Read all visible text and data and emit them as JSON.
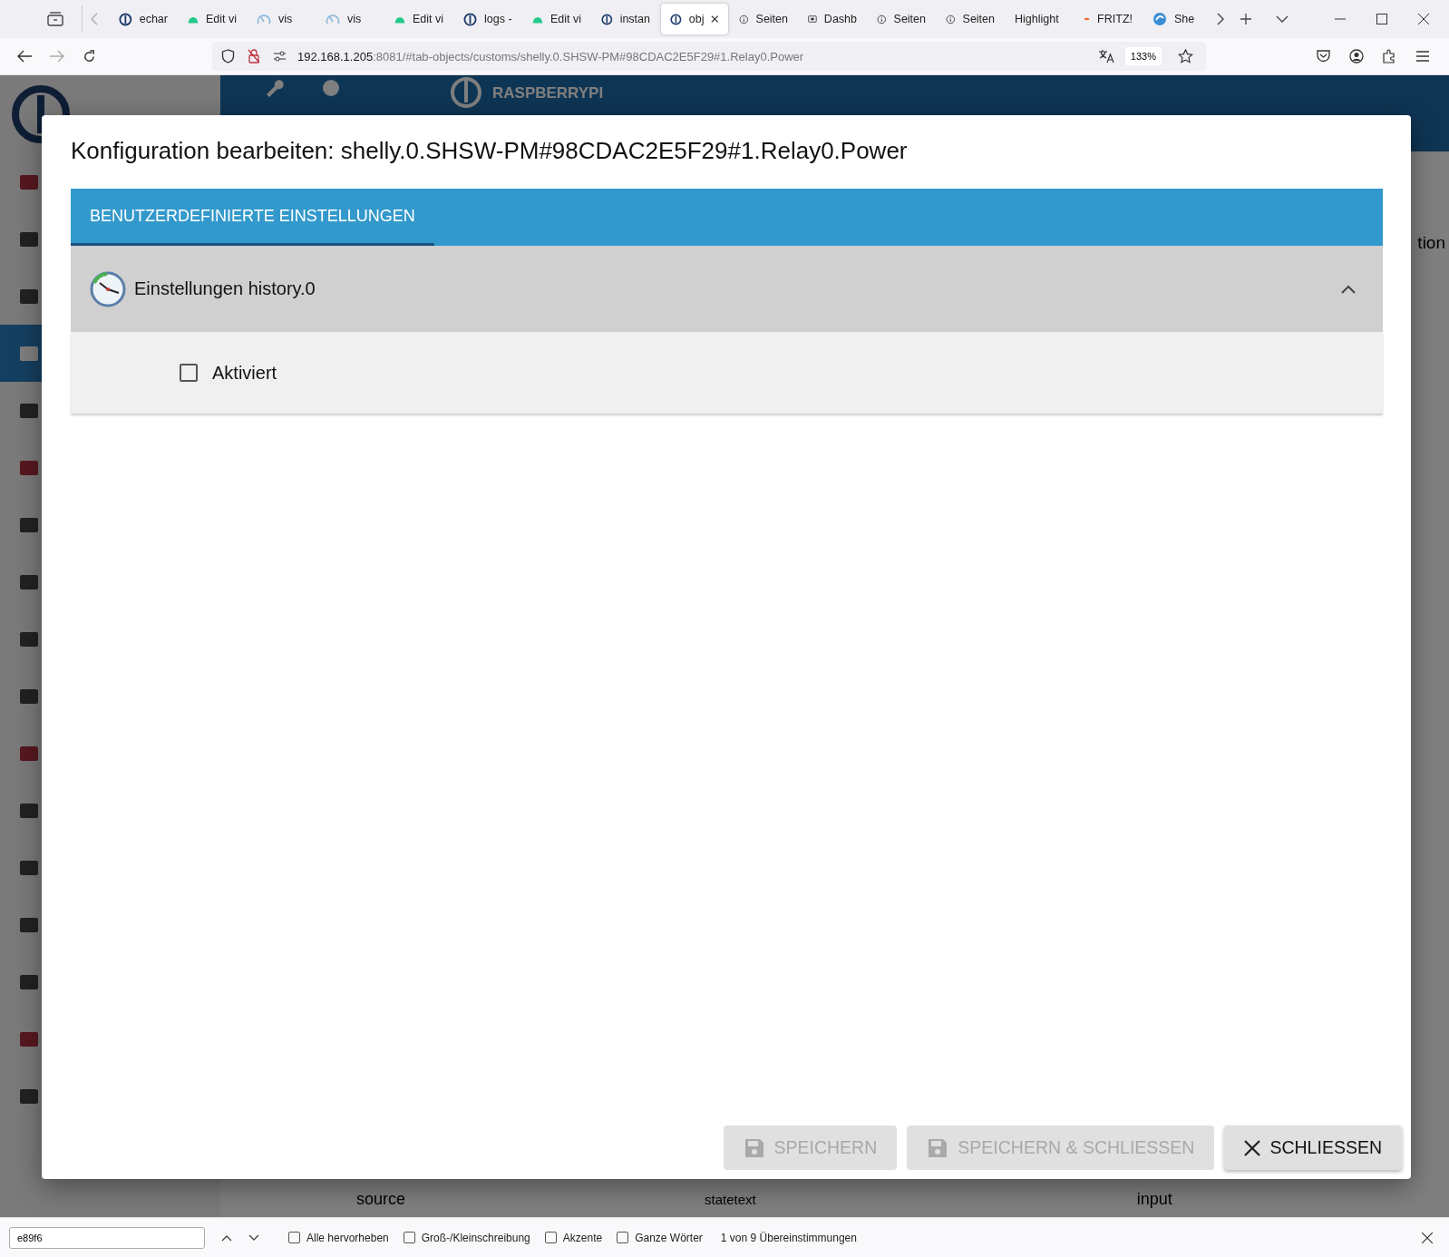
{
  "browser_tabs": [
    {
      "label": "echar",
      "kind": "iobroker",
      "selected": false
    },
    {
      "label": "Edit vi",
      "kind": "green",
      "selected": false
    },
    {
      "label": "vis",
      "kind": "gauge",
      "selected": false
    },
    {
      "label": "vis",
      "kind": "gauge",
      "selected": false
    },
    {
      "label": "Edit vi",
      "kind": "green",
      "selected": false
    },
    {
      "label": "logs -",
      "kind": "iobroker",
      "selected": false
    },
    {
      "label": "Edit vi",
      "kind": "green",
      "selected": false
    },
    {
      "label": "instan",
      "kind": "iobroker",
      "selected": false
    },
    {
      "label": "obj",
      "kind": "iobroker",
      "selected": true
    },
    {
      "label": "Seiten",
      "kind": "info",
      "selected": false
    },
    {
      "label": "Dashb",
      "kind": "dash",
      "selected": false
    },
    {
      "label": "Seiten",
      "kind": "info",
      "selected": false
    },
    {
      "label": "Seiten",
      "kind": "info",
      "selected": false
    },
    {
      "label": "Highlight",
      "kind": "text",
      "selected": false
    },
    {
      "label": "FRITZ!",
      "kind": "fritz",
      "selected": false
    },
    {
      "label": "She",
      "kind": "shelly",
      "selected": false
    }
  ],
  "address_bar": {
    "host": "192.168.1.205",
    "path": ":8081/#tab-objects/customs/shelly.0.SHSW-PM#98CDAC2E5F29#1.Relay0.Power",
    "zoom": "133%"
  },
  "background_app": {
    "host_title": "RASPBERRYPI",
    "column_fragment": "tion",
    "sidebar_items": [
      {
        "selected": false
      },
      {
        "selected": false
      },
      {
        "selected": false
      },
      {
        "selected": true
      },
      {
        "selected": false
      },
      {
        "selected": false
      },
      {
        "selected": false
      },
      {
        "selected": false
      },
      {
        "selected": false
      },
      {
        "selected": false
      },
      {
        "selected": false
      },
      {
        "selected": false
      },
      {
        "selected": false
      },
      {
        "selected": false
      },
      {
        "selected": false
      },
      {
        "selected": false
      },
      {
        "selected": false
      }
    ],
    "row": {
      "name": "source",
      "role": "statetext",
      "type": "input"
    }
  },
  "dialog": {
    "title": "Konfiguration bearbeiten: shelly.0.SHSW-PM#98CDAC2E5F29#1.Relay0.Power",
    "tabs": [
      {
        "label": "BENUTZERDEFINIERTE EINSTELLUNGEN",
        "selected": true
      }
    ],
    "section": {
      "title": "Einstellungen history.0",
      "expanded": true,
      "checkbox": {
        "label": "Aktiviert",
        "checked": false
      }
    },
    "buttons": [
      {
        "label": "SPEICHERN",
        "kind": "save",
        "disabled": true
      },
      {
        "label": "SPEICHERN & SCHLIESSEN",
        "kind": "save",
        "disabled": true
      },
      {
        "label": "SCHLIESSEN",
        "kind": "close",
        "disabled": false
      }
    ]
  },
  "find_bar": {
    "value": "e89f6",
    "options": [
      {
        "label": "Alle hervorheben",
        "checked": false
      },
      {
        "label": "Groß-/Kleinschreibung",
        "checked": false
      },
      {
        "label": "Akzente",
        "checked": false
      },
      {
        "label": "Ganze Wörter",
        "checked": false
      }
    ],
    "result": "1 von 9 Übereinstimmungen"
  }
}
